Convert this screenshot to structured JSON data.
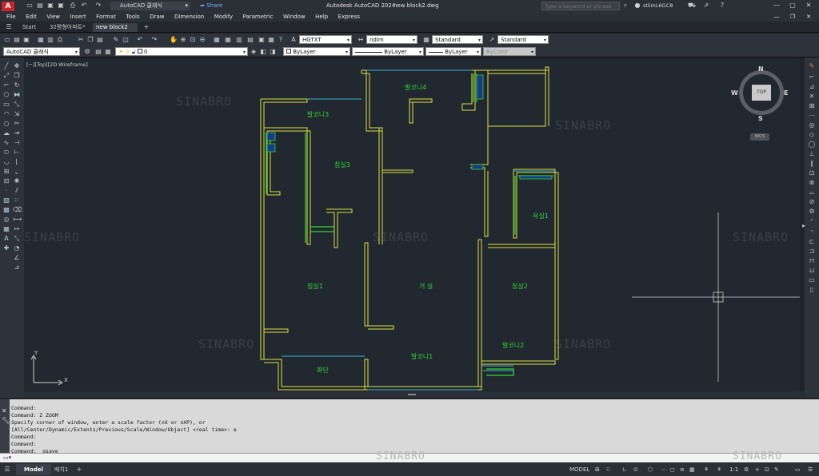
{
  "titlebar": {
    "app_logo": "A",
    "workspace": "AutoCAD 클래식",
    "share": "Share",
    "app_title": "Autodesk AutoCAD 2024",
    "file_title": "new block2.dwg",
    "search_placeholder": "Type a keyword or phrase",
    "user": "stlimL6GC8"
  },
  "menu": [
    "File",
    "Edit",
    "View",
    "Insert",
    "Format",
    "Tools",
    "Draw",
    "Dimension",
    "Modify",
    "Parametric",
    "Window",
    "Help",
    "Express"
  ],
  "tabs": [
    {
      "label": "Start"
    },
    {
      "label": "32평형아파트*"
    },
    {
      "label": "new block2"
    }
  ],
  "toolbar": {
    "text_style": "HGTXT",
    "dim_style": "ndim",
    "table_style": "Standard",
    "mleader_style": "Standard",
    "workspace_dd": "AutoCAD 클래식",
    "layer": "0",
    "color": "ByLayer",
    "linetype": "ByLayer",
    "lineweight": "ByLayer",
    "plotstyle": "ByColor"
  },
  "viewport": {
    "label": "[−][Top][2D Wireframe]",
    "viewcube_top": "TOP",
    "compass_n": "N",
    "compass_s": "S",
    "compass_e": "E",
    "compass_w": "W",
    "wcs": "WCS",
    "ucs_y": "Y",
    "ucs_x": "X"
  },
  "rooms": {
    "balcony4": "발코니4",
    "balcony3": "발코니3",
    "bedroom3": "침실3",
    "bath1": "욕실1",
    "bedroom1": "침실1",
    "living": "거 실",
    "bedroom2": "침실2",
    "balcony2": "발코니2",
    "balcony1": "발코니1",
    "planter": "화단"
  },
  "watermark": "SINABRO",
  "command": {
    "lines": [
      "Command:",
      "Command: Z ZOOM",
      "Specify corner of window, enter a scale factor (nX or nXP), or",
      "[All/Center/Dynamic/Extents/Previous/Scale/Window/Object] <real time>: e",
      "Command:",
      "Command:",
      "Command: _qsave"
    ],
    "prompt_placeholder": ""
  },
  "status": {
    "model_tab": "Model",
    "layout_tab": "배치1",
    "model_label": "MODEL",
    "scale": "1:1"
  },
  "colors": {
    "walls": "#e0e040",
    "doors": "#34d434",
    "windows": "#3ab8d0",
    "room_text": "#34d434"
  }
}
